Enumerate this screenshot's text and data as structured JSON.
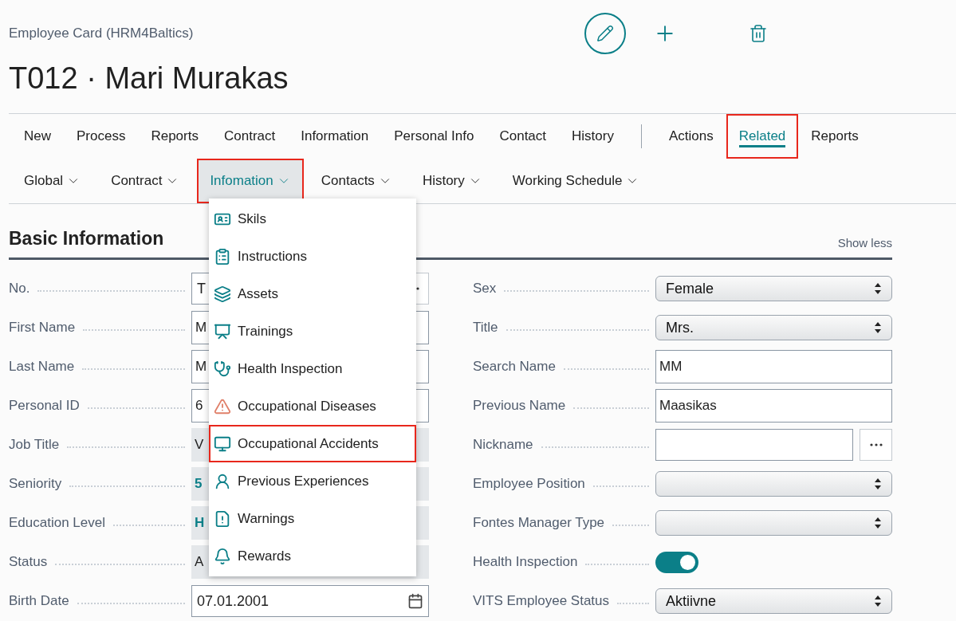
{
  "breadcrumb": "Employee Card (HRM4Baltics)",
  "title": "T012 · Mari Murakas",
  "action_bar": {
    "page_tabs": [
      {
        "label": "New"
      },
      {
        "label": "Process"
      },
      {
        "label": "Reports"
      },
      {
        "label": "Contract"
      },
      {
        "label": "Information"
      },
      {
        "label": "Personal Info"
      },
      {
        "label": "Contact"
      },
      {
        "label": "History"
      }
    ],
    "menu_tabs": [
      {
        "label": "Actions",
        "selected": false,
        "highlighted": false
      },
      {
        "label": "Related",
        "selected": true,
        "highlighted": true
      },
      {
        "label": "Reports",
        "selected": false,
        "highlighted": false
      }
    ]
  },
  "sub_menu": [
    {
      "label": "Global",
      "expanded": false,
      "highlighted": false
    },
    {
      "label": "Contract",
      "expanded": false,
      "highlighted": false
    },
    {
      "label": "Infomation",
      "expanded": true,
      "highlighted": true
    },
    {
      "label": "Contacts",
      "expanded": false,
      "highlighted": false
    },
    {
      "label": "History",
      "expanded": false,
      "highlighted": false
    },
    {
      "label": "Working Schedule",
      "expanded": false,
      "highlighted": false
    }
  ],
  "dropdown": {
    "items": [
      {
        "label": "Skils",
        "highlighted": false
      },
      {
        "label": "Instructions",
        "highlighted": false
      },
      {
        "label": "Assets",
        "highlighted": false
      },
      {
        "label": "Trainings",
        "highlighted": false
      },
      {
        "label": "Health Inspection",
        "highlighted": false
      },
      {
        "label": "Occupational Diseases",
        "highlighted": false
      },
      {
        "label": "Occupational Accidents",
        "highlighted": true
      },
      {
        "label": "Previous Experiences",
        "highlighted": false
      },
      {
        "label": "Warnings",
        "highlighted": false
      },
      {
        "label": "Rewards",
        "highlighted": false
      }
    ]
  },
  "section": {
    "title": "Basic Information",
    "toggle": "Show less"
  },
  "left_fields": [
    {
      "label": "No.",
      "kind": "lookup",
      "value": "T"
    },
    {
      "label": "First Name",
      "kind": "text",
      "value": "M"
    },
    {
      "label": "Last Name",
      "kind": "text",
      "value": "M"
    },
    {
      "label": "Personal ID",
      "kind": "text",
      "value": "6"
    },
    {
      "label": "Job Title",
      "kind": "readonly",
      "value": "V"
    },
    {
      "label": "Seniority",
      "kind": "readonly_link",
      "value": "5"
    },
    {
      "label": "Education Level",
      "kind": "readonly_link",
      "value": "H"
    },
    {
      "label": "Status",
      "kind": "readonly",
      "value": "A"
    },
    {
      "label": "Birth Date",
      "kind": "date",
      "value": "07.01.2001"
    }
  ],
  "right_fields": [
    {
      "label": "Sex",
      "kind": "select",
      "value": "Female"
    },
    {
      "label": "Title",
      "kind": "select",
      "value": "Mrs."
    },
    {
      "label": "Search Name",
      "kind": "text",
      "value": "MM"
    },
    {
      "label": "Previous Name",
      "kind": "text",
      "value": "Maasikas"
    },
    {
      "label": "Nickname",
      "kind": "lookup"
    },
    {
      "label": "Employee Position",
      "kind": "select"
    },
    {
      "label": "Fontes Manager Type",
      "kind": "select"
    },
    {
      "label": "Health Inspection",
      "kind": "toggle",
      "on": true
    },
    {
      "label": "VITS Employee Status",
      "kind": "select",
      "value": "Aktiivne"
    }
  ]
}
